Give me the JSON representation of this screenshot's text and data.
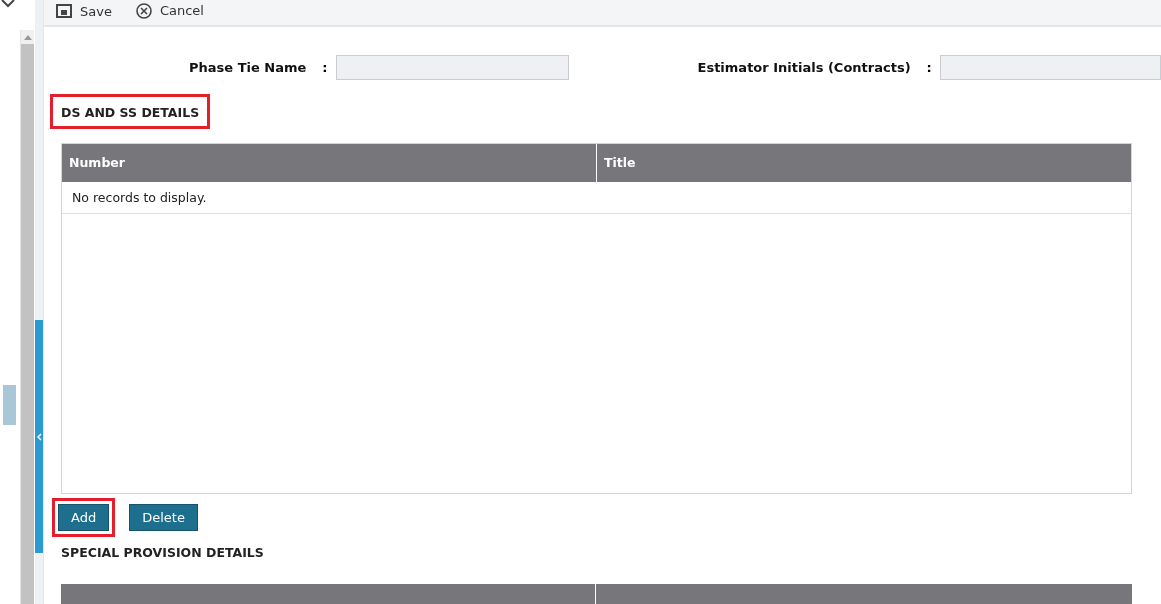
{
  "toolbar": {
    "buttons": [
      {
        "label": "Save",
        "kind": "save"
      },
      {
        "label": "Cancel",
        "kind": "cancel"
      }
    ]
  },
  "form": {
    "fields": [
      {
        "label": "Phase Tie Name",
        "separator": ":"
      },
      {
        "label": "Estimator Initials (Contracts)",
        "separator": ":"
      }
    ]
  },
  "ds_ss_section": {
    "title": "DS AND SS DETAILS",
    "highlighted": true,
    "table": {
      "columns": [
        "Number",
        "Title"
      ],
      "empty_message": "No records to display."
    },
    "buttons": [
      {
        "label": "Add",
        "highlighted": true
      },
      {
        "label": "Delete",
        "highlighted": false
      }
    ]
  },
  "special_provision_section": {
    "title": "SPECIAL PROVISION DETAILS"
  }
}
